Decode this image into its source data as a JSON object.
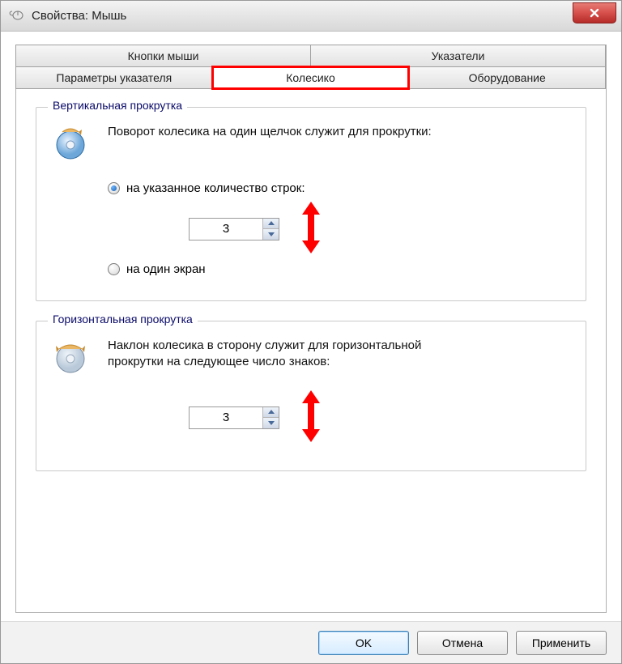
{
  "window": {
    "title": "Свойства: Мышь"
  },
  "tabs": {
    "row1": [
      {
        "label": "Кнопки мыши"
      },
      {
        "label": "Указатели"
      }
    ],
    "row2": [
      {
        "label": "Параметры указателя"
      },
      {
        "label": "Колесико"
      },
      {
        "label": "Оборудование"
      }
    ],
    "active": "Колесико"
  },
  "vertical": {
    "legend": "Вертикальная прокрутка",
    "desc": "Поворот колесика на один щелчок служит для прокрутки:",
    "option_lines": "на указанное количество строк:",
    "option_screen": "на один экран",
    "lines_value": "3"
  },
  "horizontal": {
    "legend": "Горизонтальная прокрутка",
    "desc": "Наклон колесика в сторону служит для горизонтальной прокрутки на следующее число знаков:",
    "chars_value": "3"
  },
  "buttons": {
    "ok": "OK",
    "cancel": "Отмена",
    "apply": "Применить"
  }
}
